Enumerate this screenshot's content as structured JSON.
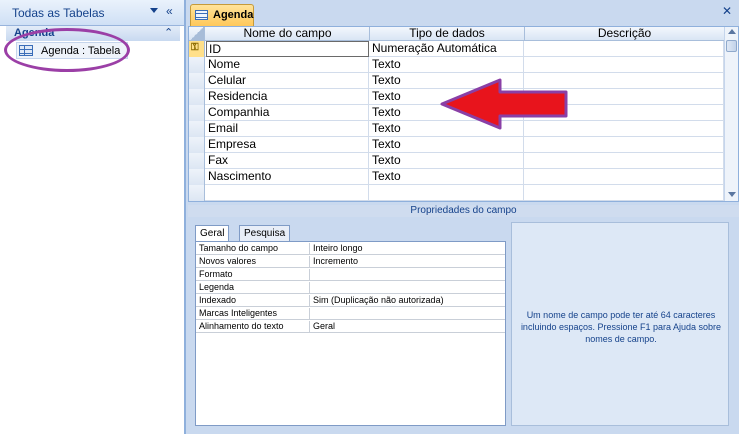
{
  "nav": {
    "title": "Todas as Tabelas",
    "group": "Agenda",
    "items": [
      {
        "label": "Agenda : Tabela"
      }
    ]
  },
  "tab": {
    "label": "Agenda"
  },
  "grid": {
    "headers": [
      "Nome do campo",
      "Tipo de dados",
      "Descrição"
    ],
    "rows": [
      {
        "name": "ID",
        "type": "Numeração Automática",
        "primary_key": true
      },
      {
        "name": "Nome",
        "type": "Texto"
      },
      {
        "name": "Celular",
        "type": "Texto"
      },
      {
        "name": "Residencia",
        "type": "Texto"
      },
      {
        "name": "Companhia",
        "type": "Texto"
      },
      {
        "name": "Email",
        "type": "Texto"
      },
      {
        "name": "Empresa",
        "type": "Texto"
      },
      {
        "name": "Fax",
        "type": "Texto"
      },
      {
        "name": "Nascimento",
        "type": "Texto"
      }
    ]
  },
  "properties": {
    "title": "Propriedades do campo",
    "tabs": [
      "Geral",
      "Pesquisa"
    ],
    "rows": [
      {
        "k": "Tamanho do campo",
        "v": "Inteiro longo"
      },
      {
        "k": "Novos valores",
        "v": "Incremento"
      },
      {
        "k": "Formato",
        "v": ""
      },
      {
        "k": "Legenda",
        "v": ""
      },
      {
        "k": "Indexado",
        "v": "Sim (Duplicação não autorizada)"
      },
      {
        "k": "Marcas Inteligentes",
        "v": ""
      },
      {
        "k": "Alinhamento do texto",
        "v": "Geral"
      }
    ],
    "help": "Um nome de campo pode ter até 64 caracteres incluindo espaços. Pressione F1 para Ajuda sobre nomes de campo."
  },
  "colors": {
    "annotation_circle": "#9b3fa6",
    "annotation_arrow": "#e8141c",
    "accent": "#15428b"
  },
  "icons": {
    "key": "primary-key-icon",
    "table": "table-icon"
  }
}
